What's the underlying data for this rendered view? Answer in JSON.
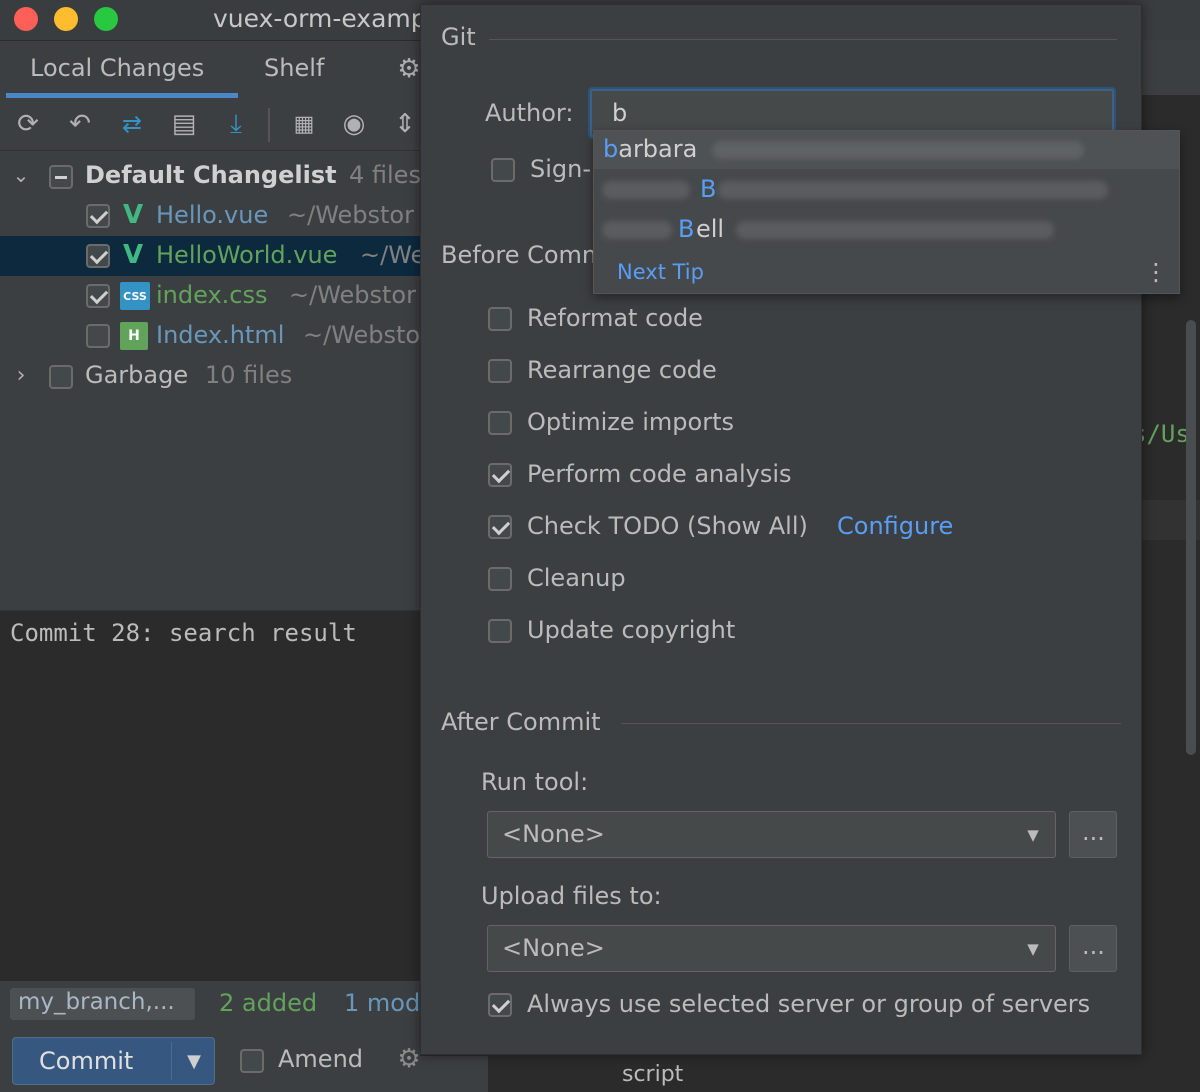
{
  "window": {
    "title": "vuex-orm-examp"
  },
  "tabs": {
    "local_changes": "Local Changes",
    "shelf": "Shelf"
  },
  "changelist": {
    "name": "Default Changelist",
    "count": "4 files",
    "files": [
      {
        "name": "Hello.vue",
        "path": "~/Webstor",
        "checked": true,
        "color": "#6897bb"
      },
      {
        "name": "HelloWorld.vue",
        "path": "~/We",
        "checked": true,
        "color": "#62a35b"
      },
      {
        "name": "index.css",
        "path": "~/Webstor",
        "checked": true,
        "color": "#62a35b"
      },
      {
        "name": "Index.html",
        "path": "~/Websto",
        "checked": false,
        "color": "#6897bb"
      }
    ],
    "garbage": {
      "name": "Garbage",
      "count": "10 files"
    }
  },
  "commit_message": "Commit 28: search result",
  "status": {
    "branch": "my_branch,...",
    "added": "2 added",
    "modified": "1 mod"
  },
  "bottom": {
    "commit_label": "Commit",
    "amend_label": "Amend"
  },
  "popup": {
    "git_section": "Git",
    "author_label": "Author:",
    "author_value": "b",
    "signoff_label": "Sign-",
    "before_commit_title": "Before Comm",
    "before_commit_options": [
      {
        "label": "Reformat code",
        "checked": false
      },
      {
        "label": "Rearrange code",
        "checked": false
      },
      {
        "label": "Optimize imports",
        "checked": false
      },
      {
        "label": "Perform code analysis",
        "checked": true
      },
      {
        "label": "Check TODO (Show All)",
        "checked": true
      },
      {
        "label": "Cleanup",
        "checked": false
      },
      {
        "label": "Update copyright",
        "checked": false
      }
    ],
    "configure_link": "Configure",
    "after_commit_title": "After Commit",
    "run_tool_label": "Run tool:",
    "run_tool_value": "<None>",
    "upload_label": "Upload files to:",
    "upload_value": "<None>",
    "browse_label": "...",
    "always_use_label": "Always use selected server or group of servers",
    "always_use_checked": true
  },
  "autocomplete": {
    "items": [
      {
        "match": "b",
        "rest": "arbara"
      },
      {
        "match": "B",
        "rest": ""
      },
      {
        "match": "B",
        "rest": "ell"
      }
    ],
    "next_tip": "Next Tip"
  },
  "editor": {
    "snippet": "s/Us",
    "bottom_tab": "script"
  },
  "colors": {
    "background": "#3c3f41",
    "popup": "#3c3f41",
    "selection": "#0d293e",
    "link": "#589df6",
    "added": "#62a35b",
    "modified": "#6897bb"
  }
}
